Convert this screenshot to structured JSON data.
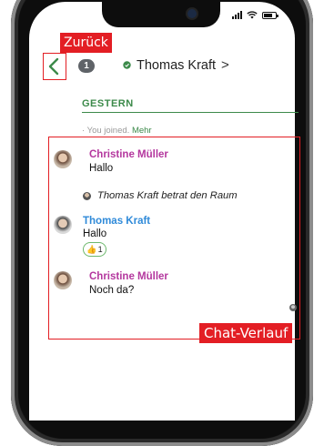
{
  "callouts": {
    "back": "Zurück",
    "chat": "Chat-Verlauf"
  },
  "header": {
    "unread_count": "1",
    "title": "Thomas Kraft",
    "title_chevron": ">"
  },
  "timeline": {
    "day_label": "GESTERN",
    "joined_text": "· You joined.",
    "more_link": "Mehr"
  },
  "messages": [
    {
      "author": "Christine Müller",
      "text": "Hallo",
      "author_color": "#b4379e"
    },
    {
      "system": "Thomas Kraft betrat den Raum"
    },
    {
      "author": "Thomas Kraft",
      "text": "Hallo",
      "author_color": "#2f8ad9",
      "reaction": {
        "emoji": "👍",
        "count": "1"
      }
    },
    {
      "author": "Christine Müller",
      "text": "Noch da?",
      "author_color": "#b4379e"
    }
  ],
  "colors": {
    "accent_green": "#3c8a4a",
    "callout_red": "#e31e24"
  },
  "icons": [
    "back-arrow-icon",
    "online-shield-icon",
    "signal-icon",
    "wifi-icon",
    "battery-icon"
  ]
}
